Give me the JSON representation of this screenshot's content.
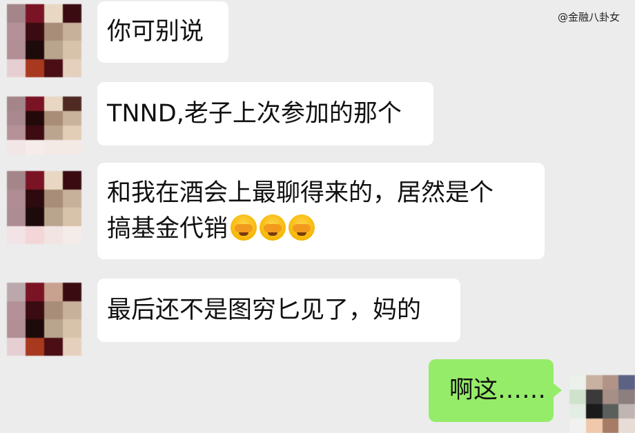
{
  "watermark": "@金融八卦女",
  "messages": [
    {
      "side": "left",
      "text": "你可别说"
    },
    {
      "side": "left",
      "text": "TNND,老子上次参加的那个"
    },
    {
      "side": "left",
      "line1": "和我在酒会上最聊得来的，居然是个",
      "line2": "搞基金代销",
      "emoji_count": 3,
      "emoji_name": "facepalm-cry-emoji"
    },
    {
      "side": "left",
      "text": "最后还不是图穷匕见了，妈的"
    },
    {
      "side": "right",
      "text": "啊这……"
    }
  ],
  "colors": {
    "background": "#ececec",
    "incoming_bubble": "#ffffff",
    "outgoing_bubble": "#95ec69"
  }
}
